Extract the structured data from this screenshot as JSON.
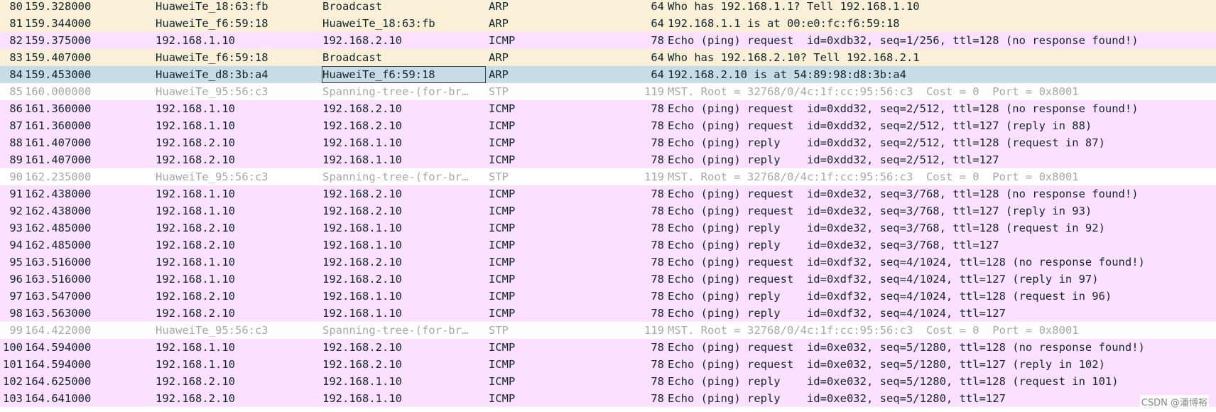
{
  "packets": [
    {
      "no": "80",
      "time": "159.328000",
      "source": "HuaweiTe_18:63:fb",
      "destination": "Broadcast",
      "protocol": "ARP",
      "length": "64",
      "info": "Who has 192.168.1.1? Tell 192.168.1.10",
      "color": "arp",
      "selected": false
    },
    {
      "no": "81",
      "time": "159.344000",
      "source": "HuaweiTe_f6:59:18",
      "destination": "HuaweiTe_18:63:fb",
      "protocol": "ARP",
      "length": "64",
      "info": "192.168.1.1 is at 00:e0:fc:f6:59:18",
      "color": "arp",
      "selected": false
    },
    {
      "no": "82",
      "time": "159.375000",
      "source": "192.168.1.10",
      "destination": "192.168.2.10",
      "protocol": "ICMP",
      "length": "78",
      "info": "Echo (ping) request  id=0xdb32, seq=1/256, ttl=128 (no response found!)",
      "color": "icmp",
      "selected": false
    },
    {
      "no": "83",
      "time": "159.407000",
      "source": "HuaweiTe_f6:59:18",
      "destination": "Broadcast",
      "protocol": "ARP",
      "length": "64",
      "info": "Who has 192.168.2.10? Tell 192.168.2.1",
      "color": "arp",
      "selected": false
    },
    {
      "no": "84",
      "time": "159.453000",
      "source": "HuaweiTe_d8:3b:a4",
      "destination": "HuaweiTe_f6:59:18",
      "protocol": "ARP",
      "length": "64",
      "info": "192.168.2.10 is at 54:89:98:d8:3b:a4",
      "color": "arp",
      "selected": true
    },
    {
      "no": "85",
      "time": "160.000000",
      "source": "HuaweiTe_95:56:c3",
      "destination": "Spanning-tree-(for-br…",
      "protocol": "STP",
      "length": "119",
      "info": "MST. Root = 32768/0/4c:1f:cc:95:56:c3  Cost = 0  Port = 0x8001",
      "color": "stp",
      "selected": false
    },
    {
      "no": "86",
      "time": "161.360000",
      "source": "192.168.1.10",
      "destination": "192.168.2.10",
      "protocol": "ICMP",
      "length": "78",
      "info": "Echo (ping) request  id=0xdd32, seq=2/512, ttl=128 (no response found!)",
      "color": "icmp",
      "selected": false
    },
    {
      "no": "87",
      "time": "161.360000",
      "source": "192.168.1.10",
      "destination": "192.168.2.10",
      "protocol": "ICMP",
      "length": "78",
      "info": "Echo (ping) request  id=0xdd32, seq=2/512, ttl=127 (reply in 88)",
      "color": "icmp",
      "selected": false
    },
    {
      "no": "88",
      "time": "161.407000",
      "source": "192.168.2.10",
      "destination": "192.168.1.10",
      "protocol": "ICMP",
      "length": "78",
      "info": "Echo (ping) reply    id=0xdd32, seq=2/512, ttl=128 (request in 87)",
      "color": "icmp",
      "selected": false
    },
    {
      "no": "89",
      "time": "161.407000",
      "source": "192.168.2.10",
      "destination": "192.168.1.10",
      "protocol": "ICMP",
      "length": "78",
      "info": "Echo (ping) reply    id=0xdd32, seq=2/512, ttl=127",
      "color": "icmp",
      "selected": false
    },
    {
      "no": "90",
      "time": "162.235000",
      "source": "HuaweiTe_95:56:c3",
      "destination": "Spanning-tree-(for-br…",
      "protocol": "STP",
      "length": "119",
      "info": "MST. Root = 32768/0/4c:1f:cc:95:56:c3  Cost = 0  Port = 0x8001",
      "color": "stp",
      "selected": false
    },
    {
      "no": "91",
      "time": "162.438000",
      "source": "192.168.1.10",
      "destination": "192.168.2.10",
      "protocol": "ICMP",
      "length": "78",
      "info": "Echo (ping) request  id=0xde32, seq=3/768, ttl=128 (no response found!)",
      "color": "icmp",
      "selected": false
    },
    {
      "no": "92",
      "time": "162.438000",
      "source": "192.168.1.10",
      "destination": "192.168.2.10",
      "protocol": "ICMP",
      "length": "78",
      "info": "Echo (ping) request  id=0xde32, seq=3/768, ttl=127 (reply in 93)",
      "color": "icmp",
      "selected": false
    },
    {
      "no": "93",
      "time": "162.485000",
      "source": "192.168.2.10",
      "destination": "192.168.1.10",
      "protocol": "ICMP",
      "length": "78",
      "info": "Echo (ping) reply    id=0xde32, seq=3/768, ttl=128 (request in 92)",
      "color": "icmp",
      "selected": false
    },
    {
      "no": "94",
      "time": "162.485000",
      "source": "192.168.2.10",
      "destination": "192.168.1.10",
      "protocol": "ICMP",
      "length": "78",
      "info": "Echo (ping) reply    id=0xde32, seq=3/768, ttl=127",
      "color": "icmp",
      "selected": false
    },
    {
      "no": "95",
      "time": "163.516000",
      "source": "192.168.1.10",
      "destination": "192.168.2.10",
      "protocol": "ICMP",
      "length": "78",
      "info": "Echo (ping) request  id=0xdf32, seq=4/1024, ttl=128 (no response found!)",
      "color": "icmp",
      "selected": false
    },
    {
      "no": "96",
      "time": "163.516000",
      "source": "192.168.1.10",
      "destination": "192.168.2.10",
      "protocol": "ICMP",
      "length": "78",
      "info": "Echo (ping) request  id=0xdf32, seq=4/1024, ttl=127 (reply in 97)",
      "color": "icmp",
      "selected": false
    },
    {
      "no": "97",
      "time": "163.547000",
      "source": "192.168.2.10",
      "destination": "192.168.1.10",
      "protocol": "ICMP",
      "length": "78",
      "info": "Echo (ping) reply    id=0xdf32, seq=4/1024, ttl=128 (request in 96)",
      "color": "icmp",
      "selected": false
    },
    {
      "no": "98",
      "time": "163.563000",
      "source": "192.168.2.10",
      "destination": "192.168.1.10",
      "protocol": "ICMP",
      "length": "78",
      "info": "Echo (ping) reply    id=0xdf32, seq=4/1024, ttl=127",
      "color": "icmp",
      "selected": false
    },
    {
      "no": "99",
      "time": "164.422000",
      "source": "HuaweiTe_95:56:c3",
      "destination": "Spanning-tree-(for-br…",
      "protocol": "STP",
      "length": "119",
      "info": "MST. Root = 32768/0/4c:1f:cc:95:56:c3  Cost = 0  Port = 0x8001",
      "color": "stp",
      "selected": false
    },
    {
      "no": "100",
      "time": "164.594000",
      "source": "192.168.1.10",
      "destination": "192.168.2.10",
      "protocol": "ICMP",
      "length": "78",
      "info": "Echo (ping) request  id=0xe032, seq=5/1280, ttl=128 (no response found!)",
      "color": "icmp",
      "selected": false
    },
    {
      "no": "101",
      "time": "164.594000",
      "source": "192.168.1.10",
      "destination": "192.168.2.10",
      "protocol": "ICMP",
      "length": "78",
      "info": "Echo (ping) request  id=0xe032, seq=5/1280, ttl=127 (reply in 102)",
      "color": "icmp",
      "selected": false
    },
    {
      "no": "102",
      "time": "164.625000",
      "source": "192.168.2.10",
      "destination": "192.168.1.10",
      "protocol": "ICMP",
      "length": "78",
      "info": "Echo (ping) reply    id=0xe032, seq=5/1280, ttl=128 (request in 101)",
      "color": "icmp",
      "selected": false
    },
    {
      "no": "103",
      "time": "164.641000",
      "source": "192.168.2.10",
      "destination": "192.168.1.10",
      "protocol": "ICMP",
      "length": "78",
      "info": "Echo (ping) reply    id=0xe032, seq=5/1280, ttl=127",
      "color": "icmp",
      "selected": false
    }
  ],
  "colors": {
    "arp_row": "#faf0d7",
    "icmp_row": "#fce0ff",
    "stp_row": "#ffffff",
    "stp_text": "#a8a8a8",
    "selected_row": "#c6dde5",
    "text": "#12272e"
  },
  "watermark": "CSDN @潘博裕"
}
